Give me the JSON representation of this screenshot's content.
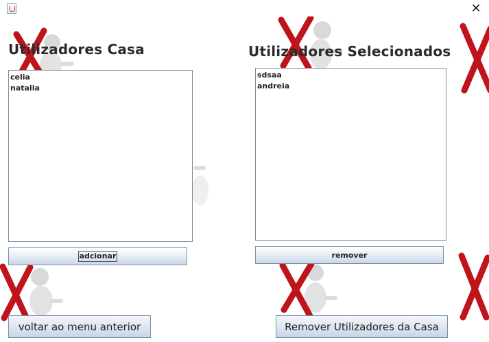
{
  "window": {
    "close_glyph": "✕"
  },
  "icons": {
    "app": "java-app-icon",
    "close": "close-icon",
    "decoration": "red-x-figure-icon"
  },
  "colors": {
    "x_red": "#c0141c",
    "figure_grey": "#d6d6d6",
    "button_border": "#7b8fa8"
  },
  "left_panel": {
    "title": "Utilizadores Casa",
    "items": [
      "celia",
      "natalia"
    ],
    "add_button_label": "adcionar"
  },
  "right_panel": {
    "title": "Utilizadores Selecionados",
    "items": [
      "sdsaa",
      "andreia"
    ],
    "remove_button_label": "remover"
  },
  "footer": {
    "back_button_label": "voltar ao menu anterior",
    "remove_users_button_label": "Remover Utilizadores da Casa"
  }
}
